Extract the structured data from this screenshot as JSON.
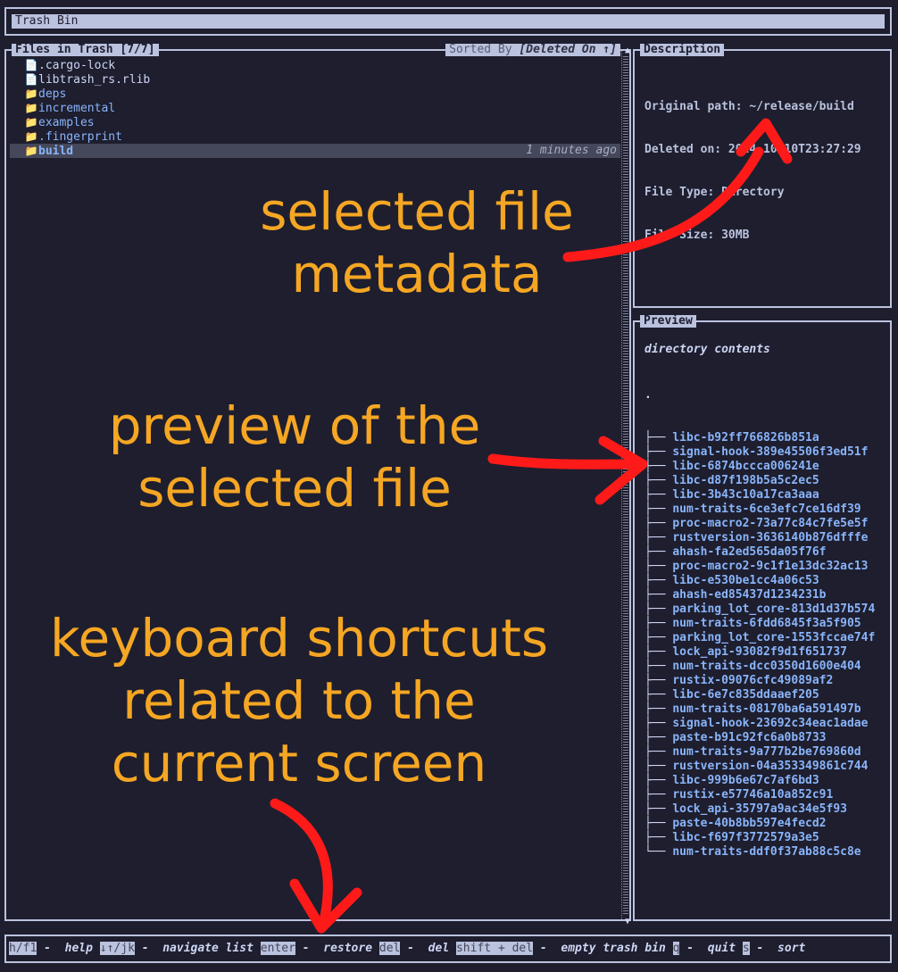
{
  "title_bar": {
    "title": "Trash Bin"
  },
  "files_panel": {
    "title": "Files in Trash [7/7]",
    "sort_prefix": "Sorted By ",
    "sort_value": "[Deleted On ↑]",
    "items": [
      {
        "icon": "file-icon",
        "name": ".cargo-lock",
        "type": "file"
      },
      {
        "icon": "file-icon",
        "name": "libtrash_rs.rlib",
        "type": "file"
      },
      {
        "icon": "folder-icon",
        "name": "deps",
        "type": "dir"
      },
      {
        "icon": "folder-icon",
        "name": "incremental",
        "type": "dir"
      },
      {
        "icon": "folder-icon",
        "name": "examples",
        "type": "dir"
      },
      {
        "icon": "folder-icon",
        "name": ".fingerprint",
        "type": "dir"
      },
      {
        "icon": "folder-icon",
        "name": "build",
        "type": "dir",
        "selected": true,
        "ago": "1 minutes ago"
      }
    ]
  },
  "description_panel": {
    "title": "Description",
    "original_path": "Original path: ~/release/build",
    "deleted_on": "Deleted on: 2024-10-10T23:27:29",
    "file_type": "File Type: Directory",
    "file_size": "File Size: 30MB"
  },
  "preview_panel": {
    "title": "Preview",
    "subtitle": "directory contents",
    "root": ".",
    "entries": [
      "libc-b92ff766826b851a",
      "signal-hook-389e45506f3ed51f",
      "libc-6874bccca006241e",
      "libc-d87f198b5a5c2ec5",
      "libc-3b43c10a17ca3aaa",
      "num-traits-6ce3efc7ce16df39",
      "proc-macro2-73a77c84c7fe5e5f",
      "rustversion-3636140b876dfffe",
      "ahash-fa2ed565da05f76f",
      "proc-macro2-9c1f1e13dc32ac13",
      "libc-e530be1cc4a06c53",
      "ahash-ed85437d1234231b",
      "parking_lot_core-813d1d37b574",
      "num-traits-6fdd6845f3a5f905",
      "parking_lot_core-1553fccae74f",
      "lock_api-93082f9d1f651737",
      "num-traits-dcc0350d1600e404",
      "rustix-09076cfc49089af2",
      "libc-6e7c835ddaaef205",
      "num-traits-08170ba6a591497b",
      "signal-hook-23692c34eac1adae",
      "paste-b91c92fc6a0b8733",
      "num-traits-9a777b2be769860d",
      "rustversion-04a353349861c744",
      "libc-999b6e67c7af6bd3",
      "rustix-e57746a10a852c91",
      "lock_api-35797a9ac34e5f93",
      "paste-40b8bb597e4fecd2",
      "libc-f697f3772579a3e5",
      "num-traits-ddf0f37ab88c5c8e"
    ]
  },
  "footer": {
    "shortcuts": [
      {
        "key": "h/f1",
        "label": "help"
      },
      {
        "key": "↓↑/jk",
        "label": "navigate list"
      },
      {
        "key": "enter",
        "label": "restore"
      },
      {
        "key": "del",
        "label": "del"
      },
      {
        "key": "shift + del",
        "label": "empty trash bin"
      },
      {
        "key": "q",
        "label": "quit"
      },
      {
        "key": "s",
        "label": "sort"
      }
    ]
  },
  "annotations": {
    "metadata": "selected file\nmetadata",
    "preview": "preview of the\nselected file",
    "shortcuts": "keyboard shortcuts\nrelated to the\ncurrent screen",
    "color": "#f5a623",
    "arrow_color": "#ff1a1a"
  }
}
